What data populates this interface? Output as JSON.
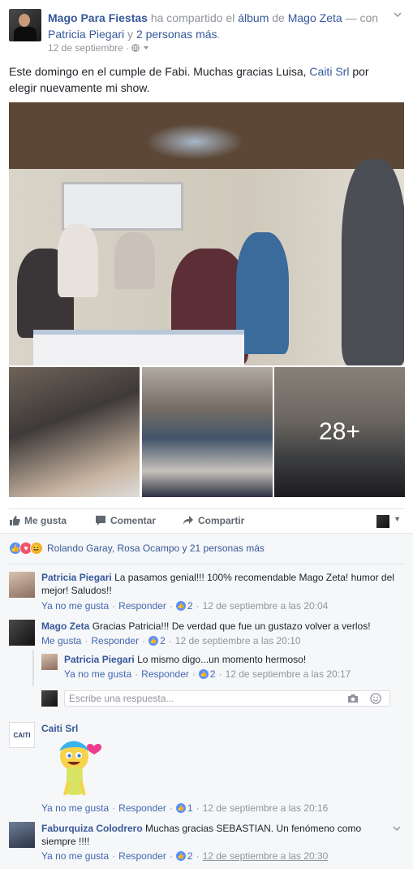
{
  "post": {
    "author": "Mago Para Fiestas",
    "shared_text": "ha compartido el",
    "album_word": "álbum",
    "of_text": "de",
    "album_owner": "Mago Zeta",
    "with_text": "— con",
    "tagged_1": "Patricia Piegari",
    "and_text": "y",
    "tagged_others": "2 personas más",
    "period": ".",
    "date": "12 de septiembre",
    "dot": "·",
    "body": "Este domingo en el cumple de Fabi. Muchas gracias Luisa,",
    "body_link": "Caiti Srl",
    "body_end": "por elegir nuevamente mi show.",
    "more_photos": "28+"
  },
  "actions": {
    "like": "Me gusta",
    "comment": "Comentar",
    "share": "Compartir"
  },
  "reactions": {
    "summary": "Rolando Garay, Rosa Ocampo y 21 personas más"
  },
  "comments": [
    {
      "author": "Patricia Piegari",
      "text": "La pasamos genial!!! 100% recomendable Mago Zeta! humor del mejor! Saludos!!",
      "unlike": "Ya no me gusta",
      "reply": "Responder",
      "likes": "2",
      "time": "12 de septiembre a las 20:04"
    },
    {
      "author": "Mago Zeta",
      "text": "Gracias Patricia!!! De verdad que fue un gustazo volver a verlos!",
      "like": "Me gusta",
      "reply": "Responder",
      "likes": "2",
      "time": "12 de septiembre a las 20:10"
    },
    {
      "author": "Patricia Piegari",
      "text": "Lo mismo digo...un momento hermoso!",
      "unlike": "Ya no me gusta",
      "reply": "Responder",
      "likes": "2",
      "time": "12 de septiembre a las 20:17"
    },
    {
      "author": "Caiti Srl",
      "avatar_text": "CAITI",
      "unlike": "Ya no me gusta",
      "reply": "Responder",
      "likes": "1",
      "time": "12 de septiembre a las 20:16"
    },
    {
      "author": "Faburquiza Colodrero",
      "text": "Muchas gracias SEBASTIAN. Un fenómeno como siempre !!!!",
      "unlike": "Ya no me gusta",
      "reply": "Responder",
      "likes": "2",
      "time": "12 de septiembre a las 20:30"
    }
  ],
  "reply_box": {
    "placeholder": "Escribe una respuesta..."
  },
  "colors": {
    "link": "#365899",
    "meta": "#90949c",
    "panel_bg": "#f6f7f9",
    "like_blue": "#5890ff",
    "love_red": "#f25268"
  }
}
